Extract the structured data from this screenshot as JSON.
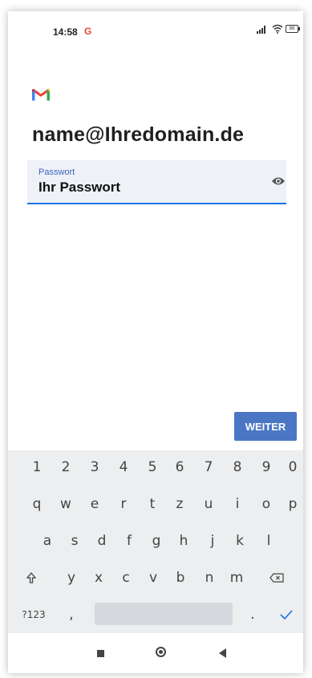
{
  "status_bar": {
    "time": "14:58",
    "notification_icon": "google-g-icon",
    "battery": "88"
  },
  "account": {
    "email": "name@Ihredomain.de"
  },
  "password_field": {
    "label": "Passwort",
    "value": "Ihr Passwort",
    "toggle_icon": "eye-icon"
  },
  "actions": {
    "next_label": "WEITER"
  },
  "keyboard": {
    "number_row": [
      "1",
      "2",
      "3",
      "4",
      "5",
      "6",
      "7",
      "8",
      "9",
      "0"
    ],
    "row1": [
      "q",
      "w",
      "e",
      "r",
      "t",
      "z",
      "u",
      "i",
      "o",
      "p"
    ],
    "row2": [
      "a",
      "s",
      "d",
      "f",
      "g",
      "h",
      "j",
      "k",
      "l"
    ],
    "row3": [
      "y",
      "x",
      "c",
      "v",
      "b",
      "n",
      "m"
    ],
    "shift_icon": "shift-arrow-icon",
    "backspace_icon": "backspace-icon",
    "symbols_label": "?123",
    "comma_label": ",",
    "period_label": ".",
    "enter_icon": "check-icon"
  },
  "nav_bar": {
    "recents_icon": "square-icon",
    "home_icon": "home-circle-icon",
    "back_icon": "back-triangle-icon"
  },
  "colors": {
    "accent": "#1a73e8",
    "button": "#4a76c4",
    "field_bg": "#eef1f6",
    "keyboard_bg": "#eceeef"
  }
}
